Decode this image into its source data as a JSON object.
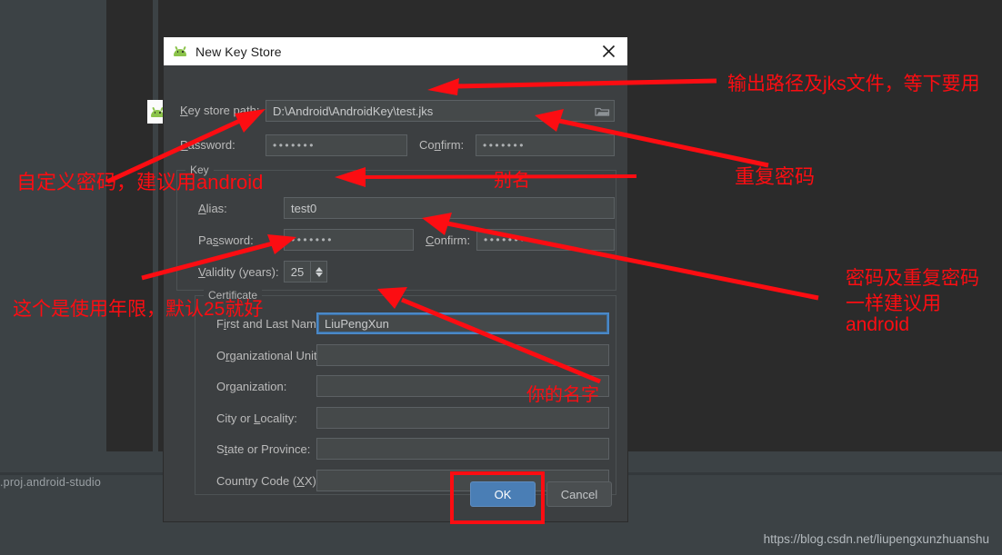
{
  "background": {
    "tab_icon": "android-icon",
    "project_label": ".proj.android-studio",
    "watermark": "https://blog.csdn.net/liupengxunzhuanshu"
  },
  "dialog": {
    "icon": "android-icon",
    "title": "New Key Store",
    "close_icon": "close-icon",
    "keystore": {
      "path_label": "Key store path:",
      "path_value": "D:\\Android\\AndroidKey\\test.jks",
      "browse_icon": "folder-icon",
      "password_label": "Password:",
      "password_value": "•••••••",
      "confirm_label": "Confirm:",
      "confirm_value": "•••••••"
    },
    "key_group": {
      "legend": "Key",
      "alias_label": "Alias:",
      "alias_value": "test0",
      "password_label": "Password:",
      "password_value": "•••••••",
      "confirm_label": "Confirm:",
      "confirm_value": "•••••••",
      "validity_label": "Validity (years):",
      "validity_value": "25"
    },
    "certificate_group": {
      "legend": "Certificate",
      "fields": [
        {
          "label": "First and Last Name:",
          "value": "LiuPengXun"
        },
        {
          "label": "Organizational Unit:",
          "value": ""
        },
        {
          "label": "Organization:",
          "value": ""
        },
        {
          "label": "City or Locality:",
          "value": ""
        },
        {
          "label": "State or Province:",
          "value": ""
        },
        {
          "label": "Country Code (XX):",
          "value": ""
        }
      ]
    },
    "buttons": {
      "ok": "OK",
      "cancel": "Cancel"
    }
  },
  "annotations": {
    "color": "#fc0d12",
    "notes": [
      {
        "id": "note-output-path",
        "text": "输出路径及jks文件，等下要用"
      },
      {
        "id": "note-custom-pw",
        "text": "自定义密码，建议用android"
      },
      {
        "id": "note-repeat-pw",
        "text": "重复密码"
      },
      {
        "id": "note-alias",
        "text": "别名"
      },
      {
        "id": "note-validity",
        "text": "这个是使用年限，默认25就好"
      },
      {
        "id": "note-pw-same-1",
        "text": "密码及重复密码"
      },
      {
        "id": "note-pw-same-2",
        "text": "一样建议用"
      },
      {
        "id": "note-pw-same-3",
        "text": "android"
      },
      {
        "id": "note-your-name",
        "text": "你的名字"
      }
    ]
  }
}
